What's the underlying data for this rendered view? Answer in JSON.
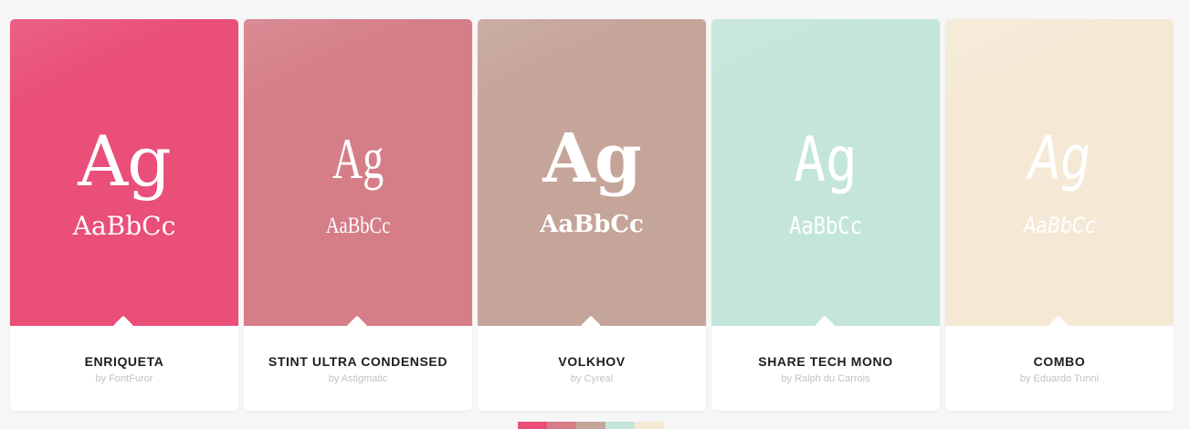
{
  "fonts": [
    {
      "name": "ENRIQUETA",
      "author": "by FontFuror",
      "sample_large": "Ag",
      "sample_small": "AaBbCc",
      "color": "#e94f79"
    },
    {
      "name": "STINT ULTRA CONDENSED",
      "author": "by Astigmatic",
      "sample_large": "Ag",
      "sample_small": "AaBbCc",
      "color": "#d57e88"
    },
    {
      "name": "VOLKHOV",
      "author": "by Cyreal",
      "sample_large": "Ag",
      "sample_small": "AaBbCc",
      "color": "#c5a49a"
    },
    {
      "name": "SHARE TECH MONO",
      "author": "by Ralph du Carrois",
      "sample_large": "Ag",
      "sample_small": "AaBbCc",
      "color": "#c4e5da"
    },
    {
      "name": "COMBO",
      "author": "by Eduardo Tunni",
      "sample_large": "Ag",
      "sample_small": "AaBbCc",
      "color": "#f5e9d6"
    }
  ],
  "palette": [
    "#e94f79",
    "#d57e88",
    "#c5a49a",
    "#c4e5da",
    "#f5e9d6"
  ]
}
